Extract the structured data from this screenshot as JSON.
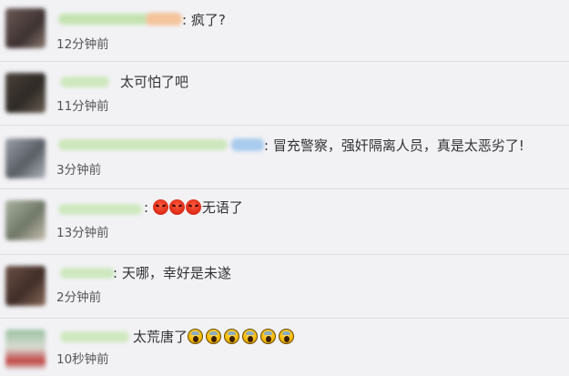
{
  "comments": [
    {
      "text": ": 疯了?",
      "time": "12分钟前"
    },
    {
      "text": "太可怕了吧",
      "time": "11分钟前"
    },
    {
      "text": ": 冒充警察，强奸隔离人员，真是太恶劣了!",
      "time": "3分钟前"
    },
    {
      "prefix": ":",
      "text": "无语了",
      "time": "13分钟前",
      "emoji": [
        "angry-face-emoji",
        "angry-face-emoji",
        "angry-face-emoji"
      ]
    },
    {
      "text": ": 天哪，幸好是未遂",
      "time": "2分钟前"
    },
    {
      "text": "太荒唐了",
      "time": "10秒钟前",
      "emoji": [
        "screaming-face-emoji",
        "screaming-face-emoji",
        "screaming-face-emoji",
        "screaming-face-emoji",
        "screaming-face-emoji",
        "screaming-face-emoji"
      ]
    }
  ],
  "colors": {
    "background": "#f2f2f5",
    "divider": "#dcdde0",
    "text": "#333333",
    "time": "#555555",
    "username_blur": "#c8e6b4"
  }
}
